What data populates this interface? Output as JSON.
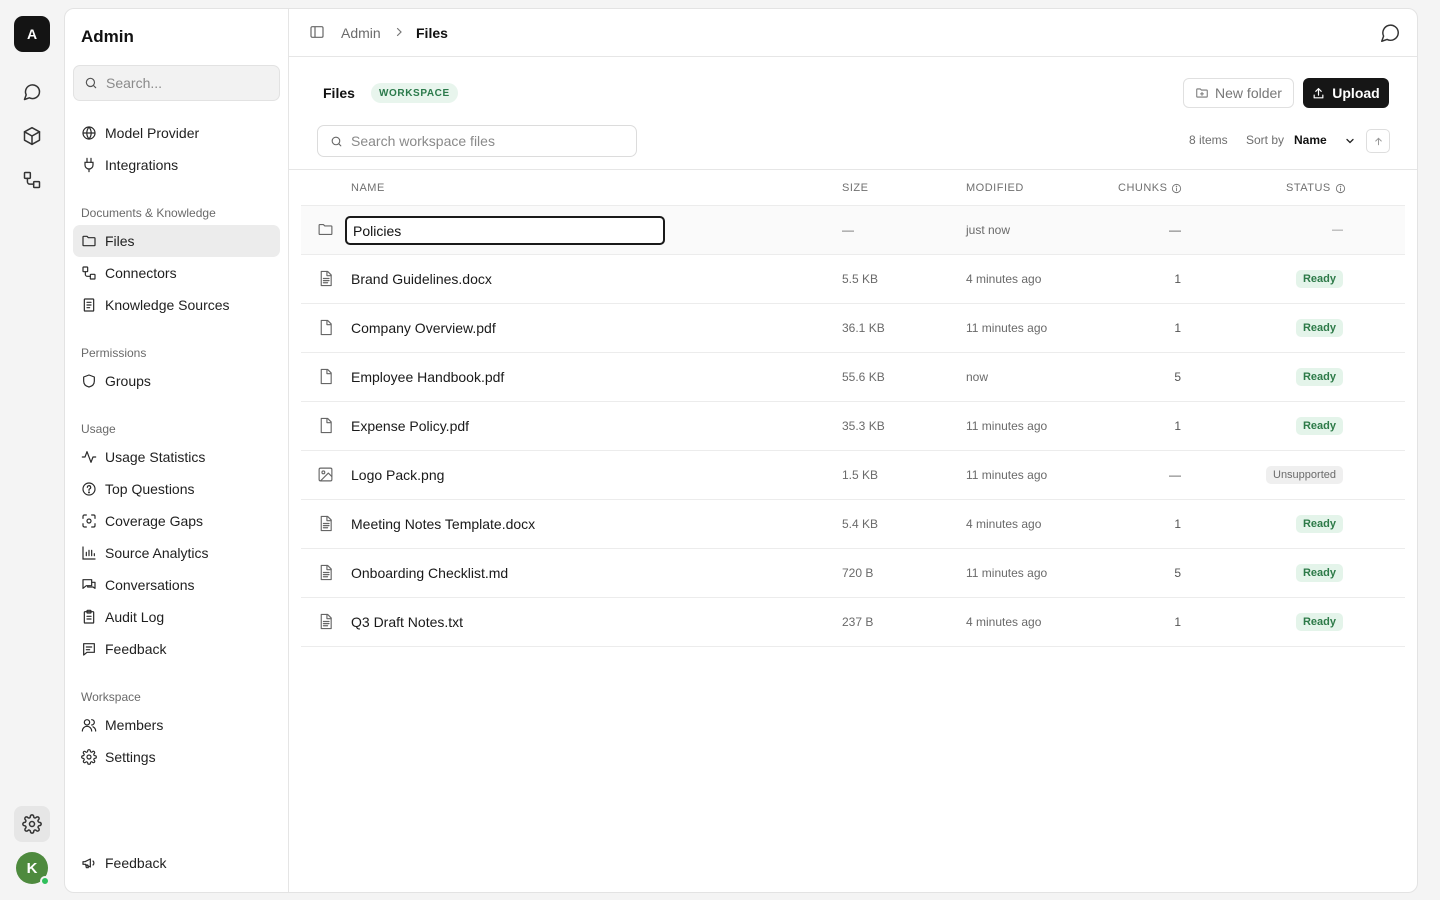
{
  "rail": {
    "workspace_initial": "A",
    "user_initial": "K",
    "items": [
      {
        "name": "chat-icon"
      },
      {
        "name": "cube-icon"
      },
      {
        "name": "workflow-icon"
      }
    ],
    "settings_icon": "gear-icon"
  },
  "sidebar": {
    "title": "Admin",
    "search_placeholder": "Search...",
    "top_items": [
      {
        "label": "Model Provider",
        "icon": "globe-icon"
      },
      {
        "label": "Integrations",
        "icon": "plug-icon"
      }
    ],
    "sections": [
      {
        "label": "Documents & Knowledge",
        "items": [
          {
            "label": "Files",
            "icon": "folder-icon",
            "active": true
          },
          {
            "label": "Connectors",
            "icon": "connector-icon"
          },
          {
            "label": "Knowledge Sources",
            "icon": "book-icon"
          }
        ]
      },
      {
        "label": "Permissions",
        "items": [
          {
            "label": "Groups",
            "icon": "shield-icon"
          }
        ]
      },
      {
        "label": "Usage",
        "items": [
          {
            "label": "Usage Statistics",
            "icon": "activity-icon"
          },
          {
            "label": "Top Questions",
            "icon": "question-icon"
          },
          {
            "label": "Coverage Gaps",
            "icon": "scan-icon"
          },
          {
            "label": "Source Analytics",
            "icon": "bar-chart-icon"
          },
          {
            "label": "Conversations",
            "icon": "messages-icon"
          },
          {
            "label": "Audit Log",
            "icon": "clipboard-icon"
          },
          {
            "label": "Feedback",
            "icon": "message-square-icon"
          }
        ]
      },
      {
        "label": "Workspace",
        "items": [
          {
            "label": "Members",
            "icon": "users-icon"
          },
          {
            "label": "Settings",
            "icon": "gear-icon"
          }
        ]
      }
    ],
    "footer_feedback": "Feedback"
  },
  "topbar": {
    "breadcrumb": [
      "Admin",
      "Files"
    ]
  },
  "page": {
    "title": "Files",
    "badge": "WORKSPACE",
    "new_folder_label": "New folder",
    "upload_label": "Upload",
    "search_placeholder": "Search workspace files",
    "items_count": "8 items",
    "sort_by_label": "Sort by",
    "sort_value": "Name",
    "sort_options": [
      "Name"
    ]
  },
  "table": {
    "columns": [
      "NAME",
      "SIZE",
      "MODIFIED",
      "CHUNKS",
      "STATUS"
    ],
    "rows": [
      {
        "name": "Policies",
        "type": "folder",
        "size": "—",
        "modified": "just now",
        "chunks": "—",
        "status": "—",
        "status_kind": "none",
        "editing": true
      },
      {
        "name": "Brand Guidelines.docx",
        "type": "doc",
        "size": "5.5 KB",
        "modified": "4 minutes ago",
        "chunks": "1",
        "status": "Ready",
        "status_kind": "ready"
      },
      {
        "name": "Company Overview.pdf",
        "type": "file",
        "size": "36.1 KB",
        "modified": "11 minutes ago",
        "chunks": "1",
        "status": "Ready",
        "status_kind": "ready"
      },
      {
        "name": "Employee Handbook.pdf",
        "type": "file",
        "size": "55.6 KB",
        "modified": "now",
        "chunks": "5",
        "status": "Ready",
        "status_kind": "ready"
      },
      {
        "name": "Expense Policy.pdf",
        "type": "file",
        "size": "35.3 KB",
        "modified": "11 minutes ago",
        "chunks": "1",
        "status": "Ready",
        "status_kind": "ready"
      },
      {
        "name": "Logo Pack.png",
        "type": "image",
        "size": "1.5 KB",
        "modified": "11 minutes ago",
        "chunks": "—",
        "status": "Unsupported",
        "status_kind": "unsupported"
      },
      {
        "name": "Meeting Notes Template.docx",
        "type": "doc",
        "size": "5.4 KB",
        "modified": "4 minutes ago",
        "chunks": "1",
        "status": "Ready",
        "status_kind": "ready"
      },
      {
        "name": "Onboarding Checklist.md",
        "type": "doc",
        "size": "720 B",
        "modified": "11 minutes ago",
        "chunks": "5",
        "status": "Ready",
        "status_kind": "ready"
      },
      {
        "name": "Q3 Draft Notes.txt",
        "type": "doc",
        "size": "237 B",
        "modified": "4 minutes ago",
        "chunks": "1",
        "status": "Ready",
        "status_kind": "ready"
      }
    ]
  },
  "colors": {
    "accent_dark": "#161616",
    "ready_bg": "#e4f4ea",
    "ready_text": "#2d7a48",
    "workspace_badge": "#2b7a4b"
  }
}
